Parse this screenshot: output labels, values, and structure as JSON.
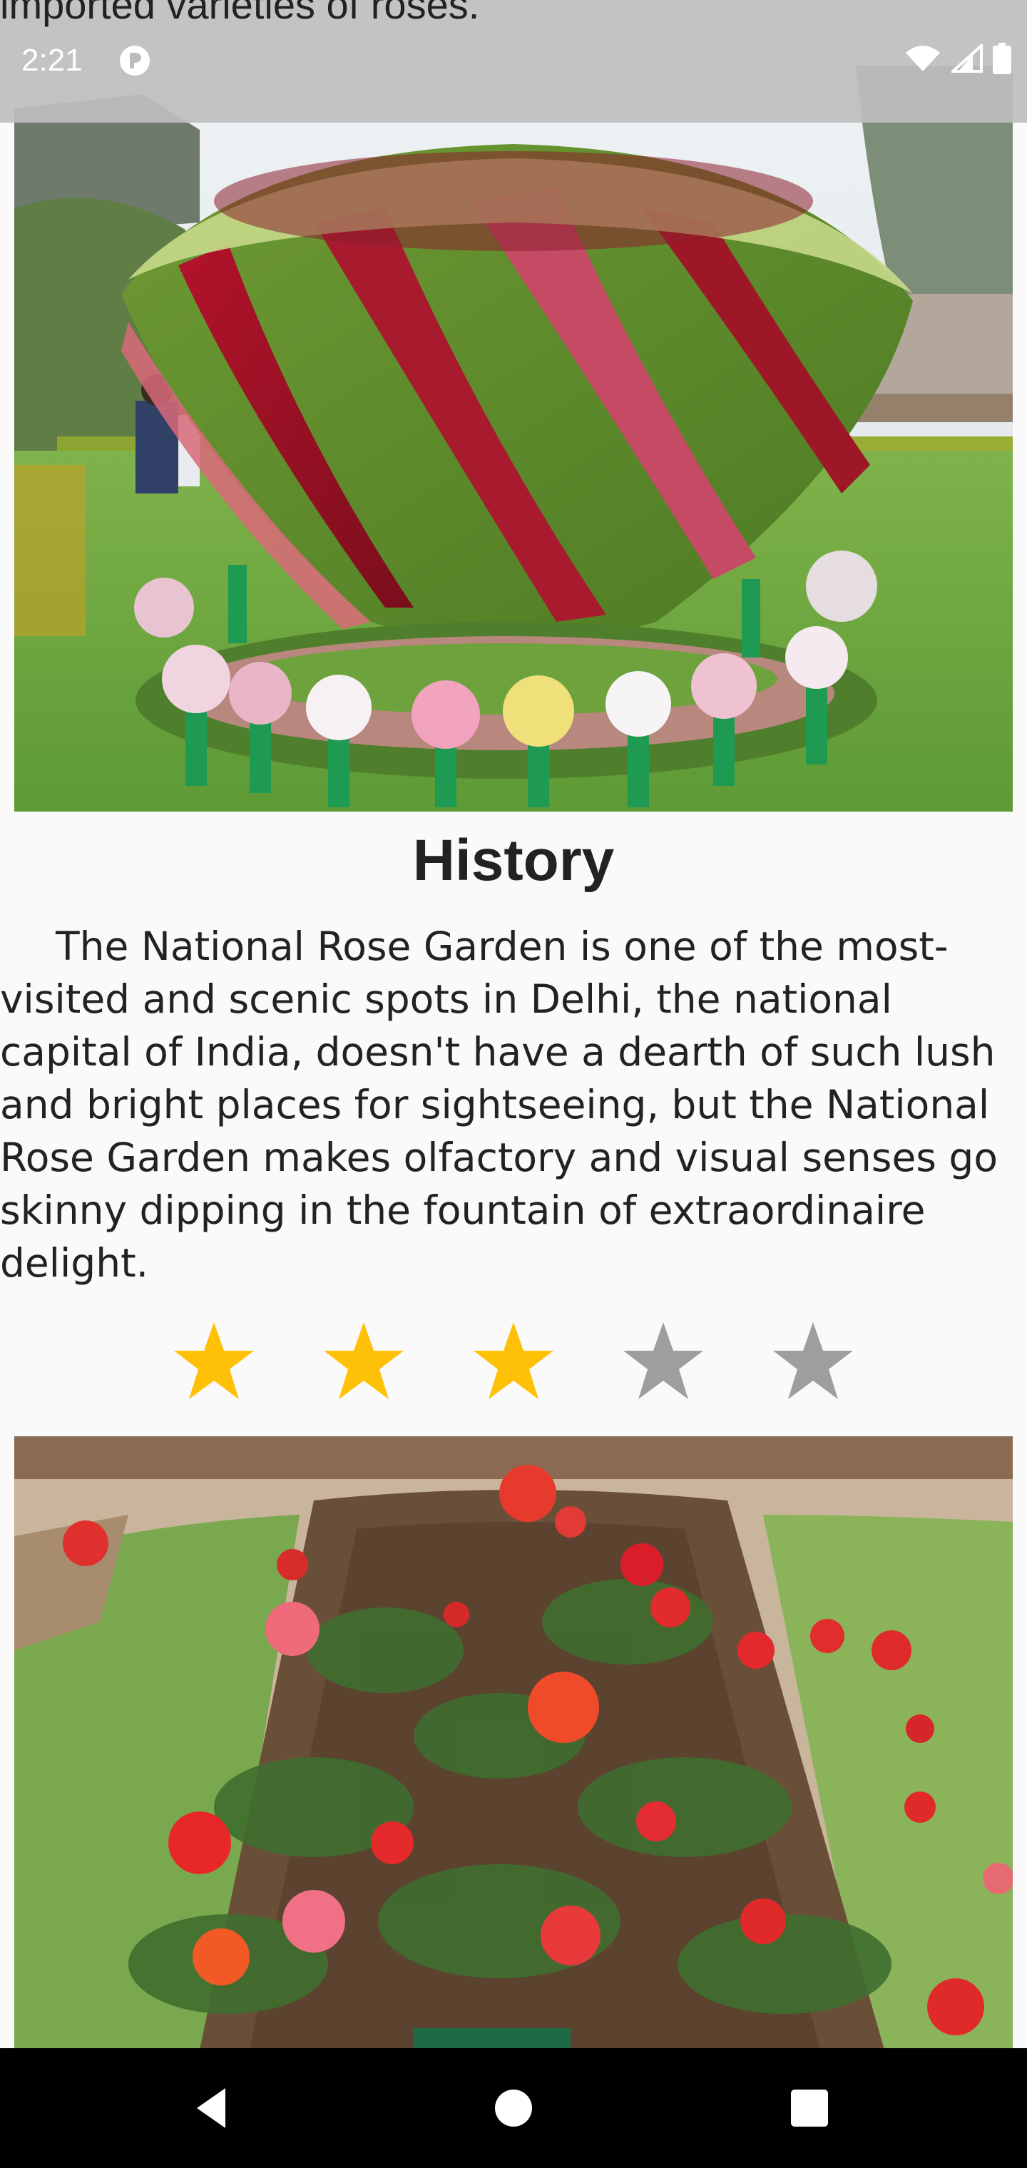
{
  "status_bar": {
    "time": "2:21",
    "icons": [
      "notification-icon",
      "wifi-icon",
      "signal-icon",
      "battery-icon"
    ]
  },
  "scrolled_text_top": "imported varieties of roses.",
  "section": {
    "heading": "History",
    "paragraph": "The National Rose Garden is one of the most-visited and scenic spots in Delhi, the national capital of India, doesn't have a dearth of such lush and bright places for sightseeing, but the National Rose Garden makes olfactory and visual senses go skinny dipping in the fountain of extraordinaire delight."
  },
  "rating": {
    "value": 3,
    "max": 5,
    "filled_color": "#FFC107",
    "empty_color": "#9E9E9E"
  },
  "nav": {
    "icons": [
      "back-icon",
      "home-icon",
      "recents-icon"
    ]
  }
}
